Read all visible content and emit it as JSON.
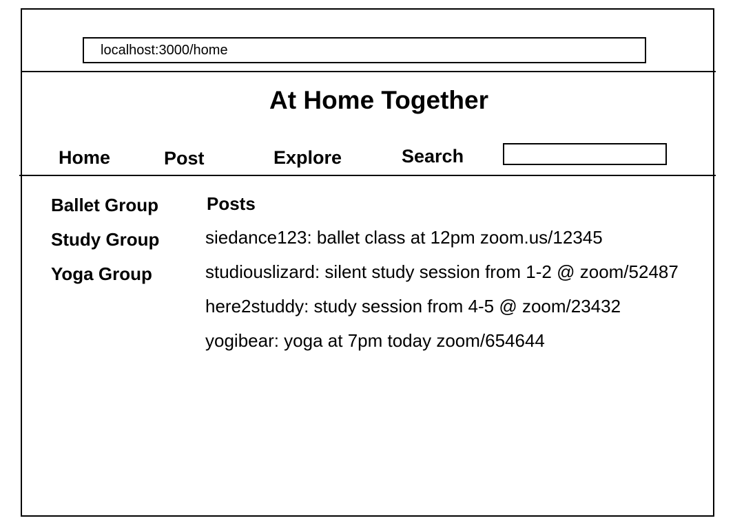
{
  "browser": {
    "url": "localhost:3000/home"
  },
  "site": {
    "title": "At Home Together"
  },
  "nav": {
    "home": "Home",
    "post": "Post",
    "explore": "Explore",
    "search": "Search",
    "search_value": ""
  },
  "groups": [
    {
      "label": "Ballet Group"
    },
    {
      "label": "Study Group"
    },
    {
      "label": "Yoga Group"
    }
  ],
  "posts": {
    "heading": "Posts",
    "items": [
      {
        "text": "siedance123: ballet class at 12pm zoom.us/12345"
      },
      {
        "text": "studiouslizard: silent study session from 1-2 @ zoom/52487"
      },
      {
        "text": "here2studdy: study session from 4-5 @ zoom/23432"
      },
      {
        "text": "yogibear: yoga at 7pm today zoom/654644"
      }
    ]
  }
}
